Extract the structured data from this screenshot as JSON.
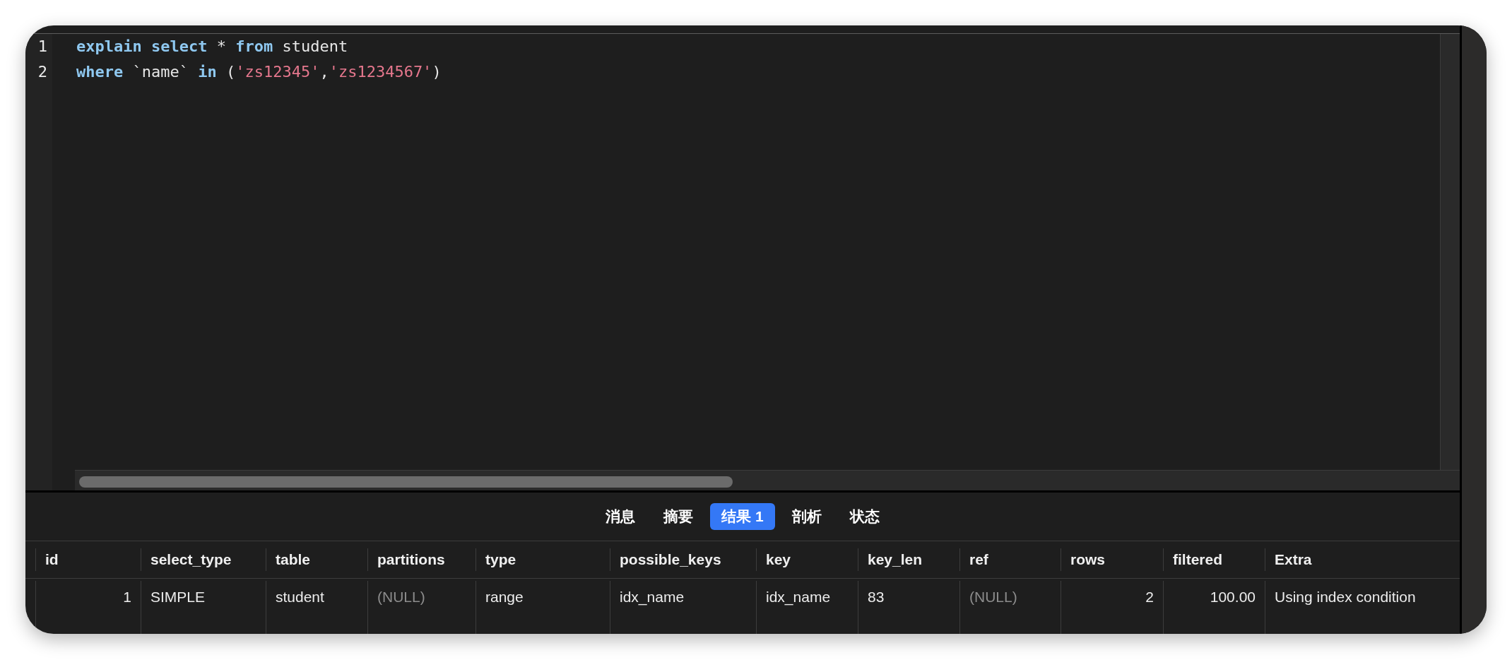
{
  "editor": {
    "lines": [
      {
        "number": "1",
        "tokens": [
          {
            "kind": "keyword",
            "text": "explain select"
          },
          {
            "kind": "plain",
            "text": " * "
          },
          {
            "kind": "keyword",
            "text": "from"
          },
          {
            "kind": "plain",
            "text": " student"
          }
        ]
      },
      {
        "number": "2",
        "tokens": [
          {
            "kind": "keyword",
            "text": "where"
          },
          {
            "kind": "plain",
            "text": " `name` "
          },
          {
            "kind": "keyword",
            "text": "in"
          },
          {
            "kind": "plain",
            "text": " ("
          },
          {
            "kind": "string",
            "text": "'zs12345'"
          },
          {
            "kind": "plain",
            "text": ","
          },
          {
            "kind": "string",
            "text": "'zs1234567'"
          },
          {
            "kind": "plain",
            "text": ")"
          }
        ]
      }
    ]
  },
  "result_tabs": [
    {
      "label": "消息",
      "selected": false
    },
    {
      "label": "摘要",
      "selected": false
    },
    {
      "label": "结果 1",
      "selected": true
    },
    {
      "label": "剖析",
      "selected": false
    },
    {
      "label": "状态",
      "selected": false
    }
  ],
  "result_table": {
    "columns": [
      "id",
      "select_type",
      "table",
      "partitions",
      "type",
      "possible_keys",
      "key",
      "key_len",
      "ref",
      "rows",
      "filtered",
      "Extra"
    ],
    "rows": [
      {
        "cells": [
          {
            "kind": "number",
            "text": "1"
          },
          {
            "kind": "text",
            "text": "SIMPLE"
          },
          {
            "kind": "text",
            "text": "student"
          },
          {
            "kind": "null",
            "text": "(NULL)"
          },
          {
            "kind": "text",
            "text": "range"
          },
          {
            "kind": "text",
            "text": "idx_name"
          },
          {
            "kind": "text",
            "text": "idx_name"
          },
          {
            "kind": "text",
            "text": "83"
          },
          {
            "kind": "null",
            "text": "(NULL)"
          },
          {
            "kind": "number",
            "text": "2"
          },
          {
            "kind": "number",
            "text": "100.00"
          },
          {
            "kind": "text",
            "text": "Using index condition"
          }
        ]
      }
    ]
  }
}
